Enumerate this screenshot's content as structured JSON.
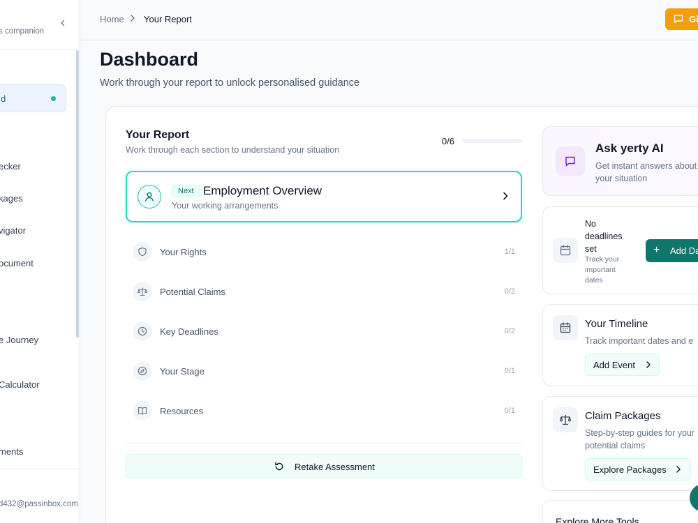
{
  "sidebar": {
    "tagline": "s companion",
    "active_item": "d",
    "items": [
      "ecker",
      "kages",
      "vigator",
      "ocument",
      "e Journey",
      "Calculator",
      "ments"
    ],
    "user_email": "d432@passinbox.com"
  },
  "topbar": {
    "breadcrumb": [
      "Home",
      "Your Report"
    ],
    "feedback_label": "Give"
  },
  "page": {
    "title": "Dashboard",
    "subtitle": "Work through your report to unlock personalised guidance"
  },
  "report": {
    "title": "Your Report",
    "subtitle": "Work through each section to understand your situation",
    "progress_text": "0/6",
    "progress_fraction": 0,
    "next": {
      "badge": "Next",
      "title": "Employment Overview",
      "subtitle": "Your working arrangements"
    },
    "sections": [
      {
        "label": "Your Rights",
        "count": "1/1",
        "icon": "shield-icon"
      },
      {
        "label": "Potential Claims",
        "count": "0/2",
        "icon": "scale-icon"
      },
      {
        "label": "Key Deadlines",
        "count": "0/2",
        "icon": "clock-icon"
      },
      {
        "label": "Your Stage",
        "count": "0/1",
        "icon": "compass-icon"
      },
      {
        "label": "Resources",
        "count": "0/1",
        "icon": "book-icon"
      }
    ],
    "retake_label": "Retake Assessment"
  },
  "ai": {
    "title": "Ask yerty AI",
    "subtitle": "Get instant answers about your situation"
  },
  "deadlines": {
    "title": "No deadlines set",
    "subtitle": "Track your important dates",
    "button": "Add Da"
  },
  "timeline": {
    "title": "Your Timeline",
    "subtitle": "Track important dates and e",
    "button": "Add Event"
  },
  "claim_packages": {
    "title": "Claim Packages",
    "subtitle": "Step-by-step guides for your potential claims",
    "button": "Explore Packages"
  },
  "explore": {
    "title": "Explore More Tools"
  },
  "colors": {
    "accent": "#14b8a6",
    "accent_dark": "#0f766e",
    "feedback": "#f59e0b",
    "ai_purple": "#7e22ce"
  }
}
